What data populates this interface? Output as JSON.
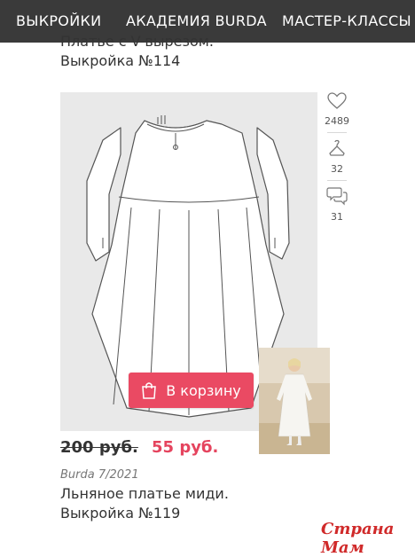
{
  "nav": {
    "items": [
      "ВЫКРОЙКИ",
      "АКАДЕМИЯ BURDA",
      "МАСТЕР-КЛАССЫ"
    ]
  },
  "previous_item": {
    "title": "Платье с V-вырезом.",
    "pattern": "Выкройка №114"
  },
  "item": {
    "stats": {
      "likes": "2489",
      "saves": "32",
      "comments": "31"
    },
    "cart_label": "В корзину",
    "old_price": "200 руб.",
    "new_price": "55 руб.",
    "issue": "Burda 7/2021",
    "title": "Льняное платье миди.",
    "pattern": "Выкройка №119"
  },
  "watermark": "Страна Мам",
  "colors": {
    "nav_bg": "#3a3a3a",
    "accent": "#ea4a63",
    "price_new": "#e5445e",
    "image_bg": "#e9e9e9"
  },
  "icons": [
    "heart-icon",
    "hanger-icon",
    "comments-icon",
    "bag-icon"
  ]
}
